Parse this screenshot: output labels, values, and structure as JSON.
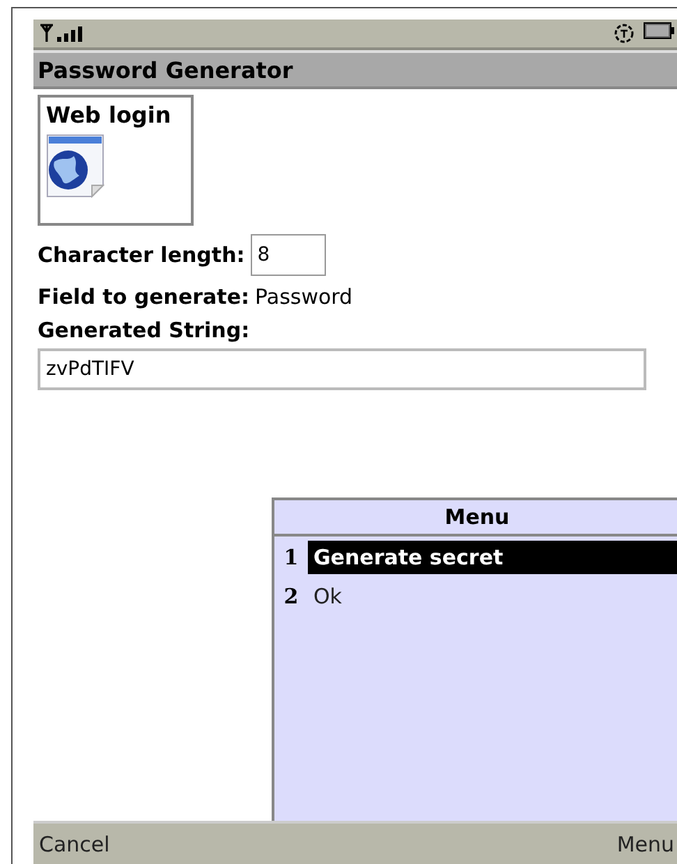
{
  "title": "Password Generator",
  "image_item": {
    "label": "Web login"
  },
  "form": [
    {
      "kind": "textfield",
      "label": "Character length:",
      "value": "8"
    },
    {
      "kind": "text",
      "label": "Field to generate:",
      "value": "Password"
    },
    {
      "kind": "stringfield",
      "label": "Generated String:",
      "value": "zvPdTIFV"
    }
  ],
  "menu": {
    "title": "Menu",
    "items": [
      {
        "number": "1",
        "label": "Generate secret",
        "selected": true
      },
      {
        "number": "2",
        "label": "Ok",
        "selected": false
      }
    ]
  },
  "softkeys": {
    "left": "Cancel",
    "right": "Menu"
  }
}
